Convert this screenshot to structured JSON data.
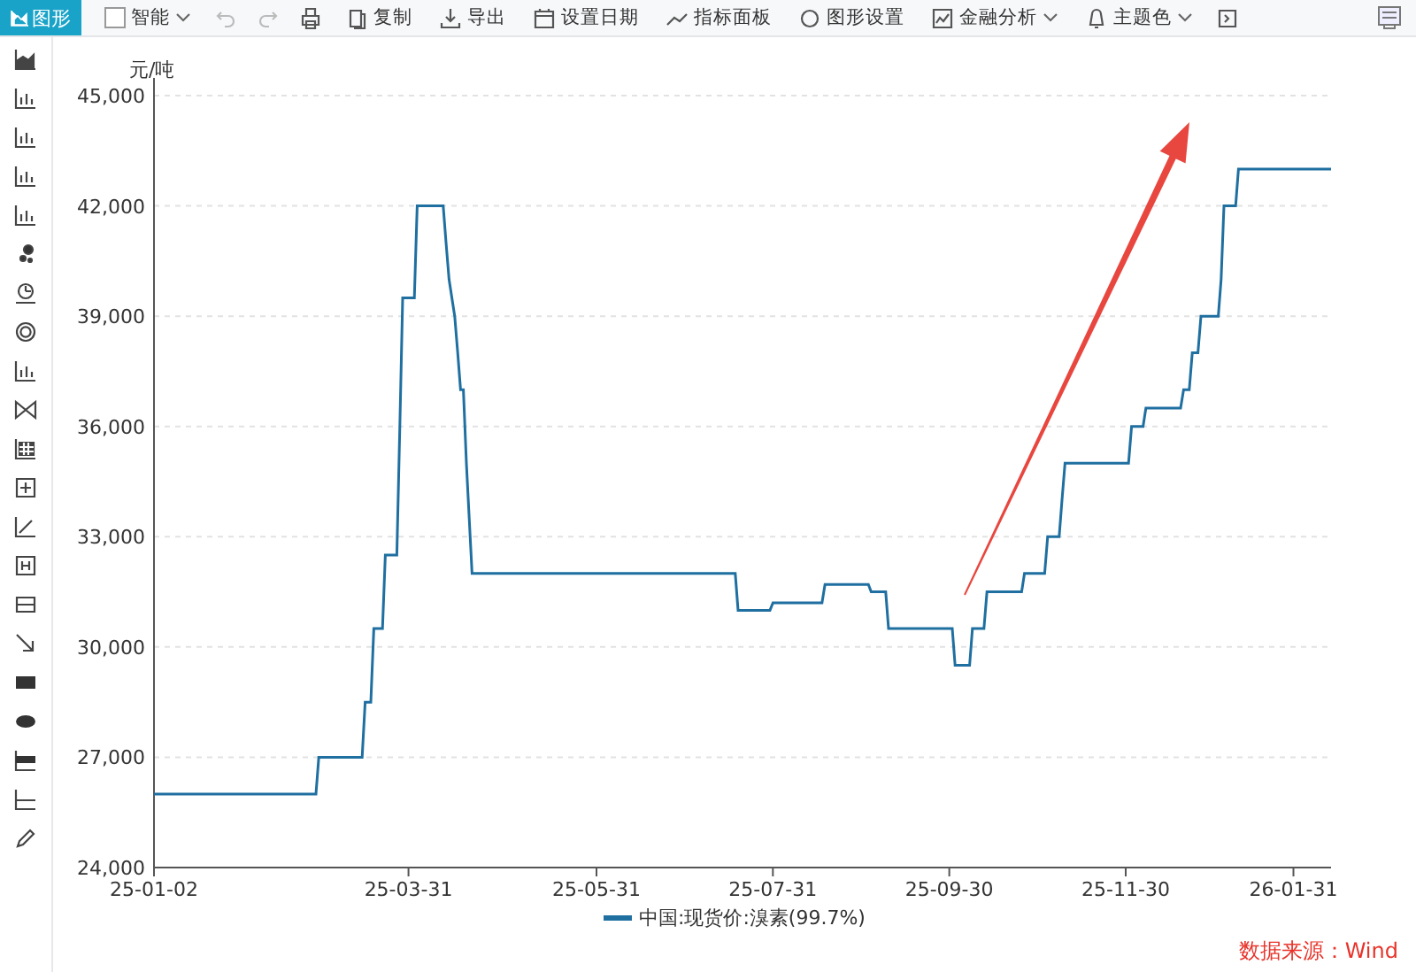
{
  "toolbar": {
    "items": [
      {
        "kind": "tab",
        "label": "图形",
        "selected": true
      },
      {
        "kind": "check",
        "label": "智能",
        "checked": false,
        "caret": true
      },
      {
        "kind": "icon"
      },
      {
        "kind": "icon"
      },
      {
        "kind": "icon"
      },
      {
        "kind": "button",
        "label": "复制",
        "caret": false
      },
      {
        "kind": "button",
        "label": "导出",
        "caret": false
      },
      {
        "kind": "button",
        "label": "设置日期",
        "caret": false
      },
      {
        "kind": "button",
        "label": "指标面板",
        "caret": false
      },
      {
        "kind": "button",
        "label": "图形设置",
        "caret": false
      },
      {
        "kind": "button",
        "label": "金融分析",
        "caret": true
      },
      {
        "kind": "button",
        "label": "主题色",
        "caret": true
      },
      {
        "kind": "icon"
      }
    ]
  },
  "chart": {
    "chart_data": {
      "type": "line",
      "grid": true,
      "ylabel": "元/吨",
      "ylim": [
        24000,
        45000
      ],
      "yticks": [
        {
          "value": 24000,
          "label": "24,000"
        },
        {
          "value": 27000,
          "label": "27,000"
        },
        {
          "value": 30000,
          "label": "30,000"
        },
        {
          "value": 33000,
          "label": "33,000"
        },
        {
          "value": 36000,
          "label": "36,000"
        },
        {
          "value": 39000,
          "label": "39,000"
        },
        {
          "value": 42000,
          "label": "42,000"
        },
        {
          "value": 45000,
          "label": "45,000"
        }
      ],
      "categories": [
        "25-01-02",
        null,
        null,
        null,
        null,
        null,
        null,
        null,
        null,
        null,
        null,
        null,
        null,
        null,
        null,
        null,
        null,
        null,
        null,
        null,
        null,
        null,
        null,
        null,
        null,
        null,
        null,
        null,
        null,
        null,
        null,
        null,
        null,
        null,
        null,
        null,
        null,
        null,
        null,
        null,
        null,
        null,
        null,
        null,
        null,
        null,
        null,
        null,
        null,
        null,
        null,
        null,
        null,
        null,
        null,
        null,
        null,
        null,
        null,
        null,
        null,
        null,
        null,
        null,
        null,
        null,
        null,
        null,
        null,
        null,
        null,
        null,
        null,
        null,
        null,
        null,
        null,
        null,
        null,
        null,
        null,
        null,
        null,
        null,
        null,
        null,
        null,
        null,
        "25-03-31",
        null,
        null,
        null,
        null,
        null,
        null,
        null,
        null,
        null,
        null,
        null,
        null,
        null,
        null,
        null,
        null,
        null,
        null,
        null,
        null,
        null,
        null,
        null,
        null,
        null,
        null,
        null,
        null,
        null,
        null,
        null,
        null,
        null,
        null,
        null,
        null,
        null,
        null,
        null,
        null,
        null,
        null,
        null,
        null,
        null,
        null,
        null,
        null,
        null,
        null,
        null,
        null,
        null,
        null,
        null,
        null,
        null,
        null,
        null,
        null,
        null,
        null,
        null,
        null,
        "25-05-31",
        null,
        null,
        null,
        null,
        null,
        null,
        null,
        null,
        null,
        null,
        null,
        null,
        null,
        null,
        null,
        null,
        null,
        null,
        null,
        null,
        null,
        null,
        null,
        null,
        null,
        null,
        null,
        null,
        null,
        null,
        null,
        null,
        null,
        null,
        null,
        null,
        null,
        null,
        null,
        null,
        null,
        null,
        null,
        null,
        null,
        null,
        null,
        null,
        null,
        null,
        null,
        null,
        null,
        null,
        null,
        null,
        null,
        null,
        null,
        null,
        "25-07-31",
        null,
        null,
        null,
        null,
        null,
        null,
        null,
        null,
        null,
        null,
        null,
        null,
        null,
        null,
        null,
        null,
        null,
        null,
        null,
        null,
        null,
        null,
        null,
        null,
        null,
        null,
        null,
        null,
        null,
        null,
        null,
        null,
        null,
        null,
        null,
        null,
        null,
        null,
        null,
        null,
        null,
        null,
        null,
        null,
        null,
        null,
        null,
        null,
        null,
        null,
        null,
        null,
        null,
        null,
        null,
        null,
        null,
        null,
        null,
        null,
        "25-09-30",
        null,
        null,
        null,
        null,
        null,
        null,
        null,
        null,
        null,
        null,
        null,
        null,
        null,
        null,
        null,
        null,
        null,
        null,
        null,
        null,
        null,
        null,
        null,
        null,
        null,
        null,
        null,
        null,
        null,
        null,
        null,
        null,
        null,
        null,
        null,
        null,
        null,
        null,
        null,
        null,
        null,
        null,
        null,
        null,
        null,
        null,
        null,
        null,
        null,
        null,
        null,
        null,
        null,
        null,
        null,
        null,
        null,
        null,
        null,
        null,
        "25-11-30",
        null,
        null,
        null,
        null,
        null,
        null,
        null,
        null,
        null,
        null,
        null,
        null,
        null,
        null,
        null,
        null,
        null,
        null,
        null,
        null,
        null,
        null,
        null,
        null,
        null,
        null,
        null,
        null,
        null,
        null,
        null,
        null,
        null,
        null,
        null,
        null,
        null,
        null,
        null,
        null,
        null,
        null,
        null,
        null,
        null,
        null,
        null,
        null,
        null,
        null,
        null,
        null,
        null,
        null,
        null,
        null,
        null,
        "26-01-31",
        null,
        null,
        null,
        null,
        null,
        null,
        null,
        null,
        null,
        null,
        null,
        null,
        null
      ],
      "series": [
        {
          "name": "中国:现货价:溴素(99.7%)",
          "color": "#1f6fa0",
          "values": [
            26000,
            26000,
            26000,
            26000,
            26000,
            26000,
            26000,
            26000,
            26000,
            26000,
            26000,
            26000,
            26000,
            26000,
            26000,
            26000,
            26000,
            26000,
            26000,
            26000,
            26000,
            26000,
            26000,
            26000,
            26000,
            26000,
            26000,
            26000,
            26000,
            26000,
            26000,
            26000,
            26000,
            26000,
            26000,
            26000,
            26000,
            26000,
            26000,
            26000,
            26000,
            26000,
            26000,
            26000,
            26000,
            26000,
            26000,
            26000,
            26000,
            26000,
            26000,
            26000,
            26000,
            26000,
            26000,
            26000,
            26000,
            27000,
            27000,
            27000,
            27000,
            27000,
            27000,
            27000,
            27000,
            27000,
            27000,
            27000,
            27000,
            27000,
            27000,
            27000,
            27000,
            28500,
            28500,
            28500,
            30500,
            30500,
            30500,
            30500,
            32500,
            32500,
            32500,
            32500,
            32500,
            36000,
            39500,
            39500,
            39500,
            39500,
            39500,
            42000,
            42000,
            42000,
            42000,
            42000,
            42000,
            42000,
            42000,
            42000,
            42000,
            41000,
            40000,
            39500,
            39000,
            38000,
            37000,
            37000,
            35000,
            33500,
            32000,
            32000,
            32000,
            32000,
            32000,
            32000,
            32000,
            32000,
            32000,
            32000,
            32000,
            32000,
            32000,
            32000,
            32000,
            32000,
            32000,
            32000,
            32000,
            32000,
            32000,
            32000,
            32000,
            32000,
            32000,
            32000,
            32000,
            32000,
            32000,
            32000,
            32000,
            32000,
            32000,
            32000,
            32000,
            32000,
            32000,
            32000,
            32000,
            32000,
            32000,
            32000,
            32000,
            32000,
            32000,
            32000,
            32000,
            32000,
            32000,
            32000,
            32000,
            32000,
            32000,
            32000,
            32000,
            32000,
            32000,
            32000,
            32000,
            32000,
            32000,
            32000,
            32000,
            32000,
            32000,
            32000,
            32000,
            32000,
            32000,
            32000,
            32000,
            32000,
            32000,
            32000,
            32000,
            32000,
            32000,
            32000,
            32000,
            32000,
            32000,
            32000,
            32000,
            32000,
            32000,
            32000,
            32000,
            32000,
            32000,
            32000,
            32000,
            32000,
            31000,
            31000,
            31000,
            31000,
            31000,
            31000,
            31000,
            31000,
            31000,
            31000,
            31000,
            31000,
            31200,
            31200,
            31200,
            31200,
            31200,
            31200,
            31200,
            31200,
            31200,
            31200,
            31200,
            31200,
            31200,
            31200,
            31200,
            31200,
            31200,
            31200,
            31700,
            31700,
            31700,
            31700,
            31700,
            31700,
            31700,
            31700,
            31700,
            31700,
            31700,
            31700,
            31700,
            31700,
            31700,
            31700,
            31500,
            31500,
            31500,
            31500,
            31500,
            31500,
            30500,
            30500,
            30500,
            30500,
            30500,
            30500,
            30500,
            30500,
            30500,
            30500,
            30500,
            30500,
            30500,
            30500,
            30500,
            30500,
            30500,
            30500,
            30500,
            30500,
            30500,
            30500,
            30500,
            29500,
            29500,
            29500,
            29500,
            29500,
            29500,
            30500,
            30500,
            30500,
            30500,
            30500,
            31500,
            31500,
            31500,
            31500,
            31500,
            31500,
            31500,
            31500,
            31500,
            31500,
            31500,
            31500,
            31500,
            32000,
            32000,
            32000,
            32000,
            32000,
            32000,
            32000,
            32000,
            33000,
            33000,
            33000,
            33000,
            33000,
            34000,
            35000,
            35000,
            35000,
            35000,
            35000,
            35000,
            35000,
            35000,
            35000,
            35000,
            35000,
            35000,
            35000,
            35000,
            35000,
            35000,
            35000,
            35000,
            35000,
            35000,
            35000,
            35000,
            35000,
            36000,
            36000,
            36000,
            36000,
            36000,
            36500,
            36500,
            36500,
            36500,
            36500,
            36500,
            36500,
            36500,
            36500,
            36500,
            36500,
            36500,
            36500,
            37000,
            37000,
            37000,
            38000,
            38000,
            38000,
            39000,
            39000,
            39000,
            39000,
            39000,
            39000,
            39000,
            40000,
            42000,
            42000,
            42000,
            42000,
            42000,
            43000,
            43000,
            43000,
            43000,
            43000,
            43000,
            43000,
            43000,
            43000,
            43000,
            43000,
            43000,
            43000,
            43000,
            43000,
            43000,
            43000,
            43000,
            43000,
            43000,
            43000,
            43000,
            43000,
            43000,
            43000,
            43000,
            43000,
            43000,
            43000,
            43000,
            43000,
            43000,
            43000
          ]
        }
      ]
    },
    "source": "数据来源：Wind"
  }
}
